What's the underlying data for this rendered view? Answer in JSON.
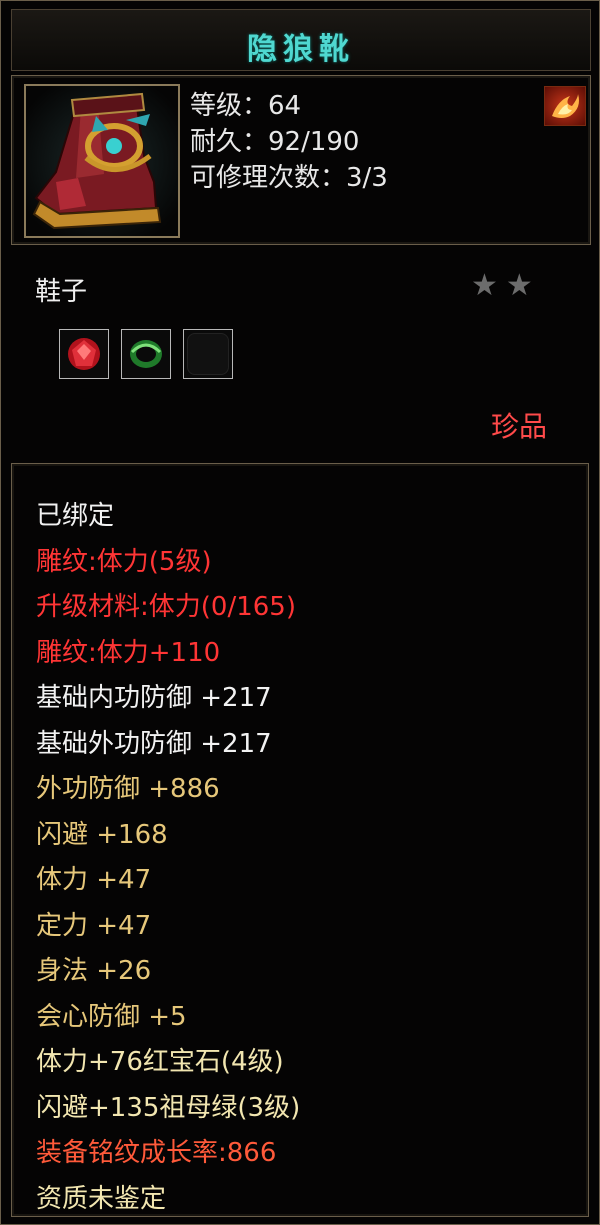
{
  "item": {
    "name": "隐狼靴",
    "level": "等级：64",
    "durability": "耐久：92/190",
    "repairs": "可修理次数：3/3",
    "type": "鞋子",
    "quality": "珍品",
    "stars_total": 2
  },
  "gems": [
    {
      "name": "ruby-gem-icon",
      "color": "#d0202a"
    },
    {
      "name": "emerald-gem-icon",
      "color": "#2fa33a"
    },
    {
      "name": "empty-gem-slot",
      "color": "#111111"
    }
  ],
  "attributes": [
    {
      "text": "已绑定",
      "color": "#f2f2f2"
    },
    {
      "text": "雕纹:体力(5级)",
      "color": "#ff3535"
    },
    {
      "text": "升级材料:体力(0/165)",
      "color": "#ff3535"
    },
    {
      "text": "雕纹:体力+110",
      "color": "#ff3535"
    },
    {
      "text": "基础内功防御 +217",
      "color": "#f2f2f2"
    },
    {
      "text": "基础外功防御 +217",
      "color": "#f2f2f2"
    },
    {
      "text": "外功防御 +886",
      "color": "#e6c77a"
    },
    {
      "text": "闪避 +168",
      "color": "#e6c77a"
    },
    {
      "text": "体力 +47",
      "color": "#e6c77a"
    },
    {
      "text": "定力 +47",
      "color": "#e6c77a"
    },
    {
      "text": "身法 +26",
      "color": "#e6c77a"
    },
    {
      "text": "会心防御 +5",
      "color": "#e6c77a"
    },
    {
      "text": "体力+76红宝石(4级)",
      "color": "#f2e6b0"
    },
    {
      "text": "闪避+135祖母绿(3级)",
      "color": "#f2e6b0"
    },
    {
      "text": "装备铭纹成长率:866",
      "color": "#ff5a3a"
    },
    {
      "text": "资质未鉴定",
      "color": "#f2e6b0"
    }
  ]
}
